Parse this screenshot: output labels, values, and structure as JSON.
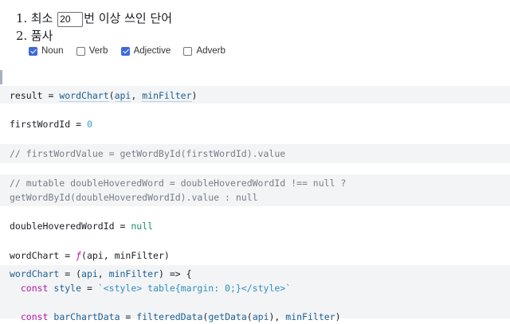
{
  "filters": {
    "row1": {
      "number": "1.",
      "before": "최소",
      "input_value": "20",
      "after": "번 이상 쓰인 단어"
    },
    "row2": {
      "number": "2.",
      "label": "품사"
    },
    "pos": [
      {
        "label": "Noun",
        "checked": true
      },
      {
        "label": "Verb",
        "checked": false
      },
      {
        "label": "Adjective",
        "checked": true
      },
      {
        "label": "Adverb",
        "checked": false
      }
    ]
  },
  "cells": {
    "result": {
      "lhs": "result",
      "eq": " = ",
      "fn": "wordChart",
      "open": "(",
      "arg1": "api",
      "sep": ", ",
      "arg2": "minFilter",
      "close": ")"
    },
    "firstWordId": {
      "lhs": "firstWordId",
      "eq": " = ",
      "value": "0"
    },
    "firstWordValue": {
      "comment": "// firstWordValue = getWordById(firstWordId).value"
    },
    "doubleHovered": {
      "line1": "// mutable doubleHoveredWord = doubleHoveredWordId !== null ?",
      "line2": "getWordById(doubleHoveredWordId).value : null"
    },
    "doubleHoveredId": {
      "lhs": "doubleHoveredWordId",
      "eq": " = ",
      "value": "null"
    },
    "wordChartSig": {
      "lhs": "wordChart",
      "eq": " = ",
      "f": "ƒ",
      "args": "(api, minFilter)"
    },
    "wordChartDef": {
      "line1_lhs": "wordChart",
      "line1_eq": " = (",
      "line1_a1": "api",
      "line1_sep": ", ",
      "line1_a2": "minFilter",
      "line1_end": ") => {",
      "line2_kw": "const",
      "line2_var": " style",
      "line2_eq": " = ",
      "line2_str": "`<style> table{margin: 0;}</style>`",
      "line4_kw": "const",
      "line4_var": " barChartData",
      "line4_eq": " = ",
      "line4_fn": "filteredData",
      "line4_o": "(",
      "line4_fn2": "getData",
      "line4_o2": "(",
      "line4_a1": "api",
      "line4_c2": "), ",
      "line4_a2": "minFilter",
      "line4_c": ")"
    }
  },
  "colors": {
    "checkbox_checked": "#3c6ad9",
    "cell_bg": "#f3f4f5",
    "keyword": "#b218a8",
    "comment": "#777d86"
  }
}
